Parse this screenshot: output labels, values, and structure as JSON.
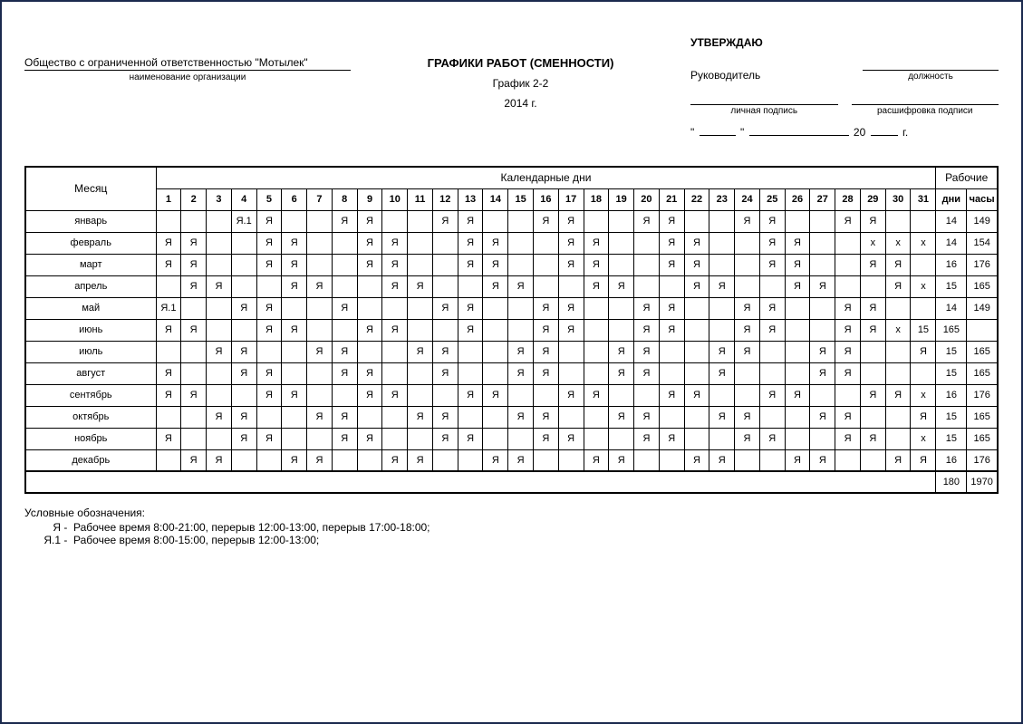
{
  "organization": {
    "name": "Общество с ограниченной ответственностью \"Мотылек\"",
    "sub_label": "наименование организации"
  },
  "title": "ГРАФИКИ РАБОТ (СМЕННОСТИ)",
  "schedule_name": "График 2-2",
  "year_label": "2014 г.",
  "approval": {
    "approve": "УТВЕРЖДАЮ",
    "manager": "Руководитель",
    "position_label": "должность",
    "signature_label": "личная подпись",
    "decryption_label": "расшифровка подписи",
    "date_prefix": "\"",
    "date_mid": "\"",
    "date_year_prefix": "20",
    "date_suffix": "г."
  },
  "table": {
    "month_header": "Месяц",
    "calendar_header": "Календарные дни",
    "work_header": "Рабочие",
    "days_col": "дни",
    "hours_col": "часы",
    "day_numbers": [
      "1",
      "2",
      "3",
      "4",
      "5",
      "6",
      "7",
      "8",
      "9",
      "10",
      "11",
      "12",
      "13",
      "14",
      "15",
      "16",
      "17",
      "18",
      "19",
      "20",
      "21",
      "22",
      "23",
      "24",
      "25",
      "26",
      "27",
      "28",
      "29",
      "30",
      "31"
    ],
    "rows": [
      {
        "month": "январь",
        "cells": [
          "",
          "",
          "",
          "Я.1",
          "Я",
          "",
          "",
          "Я",
          "Я",
          "",
          "",
          "Я",
          "Я",
          "",
          "",
          "Я",
          "Я",
          "",
          "",
          "Я",
          "Я",
          "",
          "",
          "Я",
          "Я",
          "",
          "",
          "Я",
          "Я",
          "",
          ""
        ],
        "days": "14",
        "hours": "149"
      },
      {
        "month": "февраль",
        "cells": [
          "Я",
          "Я",
          "",
          "",
          "Я",
          "Я",
          "",
          "",
          "Я",
          "Я",
          "",
          "",
          "Я",
          "Я",
          "",
          "",
          "Я",
          "Я",
          "",
          "",
          "Я",
          "Я",
          "",
          "",
          "Я",
          "Я",
          "",
          "",
          "х",
          "х",
          "х"
        ],
        "days": "14",
        "hours": "154"
      },
      {
        "month": "март",
        "cells": [
          "Я",
          "Я",
          "",
          "",
          "Я",
          "Я",
          "",
          "",
          "Я",
          "Я",
          "",
          "",
          "Я",
          "Я",
          "",
          "",
          "Я",
          "Я",
          "",
          "",
          "Я",
          "Я",
          "",
          "",
          "Я",
          "Я",
          "",
          "",
          "Я",
          "Я",
          ""
        ],
        "days": "16",
        "hours": "176"
      },
      {
        "month": "апрель",
        "cells": [
          "",
          "Я",
          "Я",
          "",
          "",
          "Я",
          "Я",
          "",
          "",
          "Я",
          "Я",
          "",
          "",
          "Я",
          "Я",
          "",
          "",
          "Я",
          "Я",
          "",
          "",
          "Я",
          "Я",
          "",
          "",
          "Я",
          "Я",
          "",
          "",
          "Я",
          "х"
        ],
        "days": "15",
        "hours": "165"
      },
      {
        "month": "май",
        "cells": [
          "Я.1",
          "",
          "",
          "Я",
          "Я",
          "",
          "",
          "Я",
          "",
          "",
          "",
          "Я",
          "Я",
          "",
          "",
          "Я",
          "Я",
          "",
          "",
          "Я",
          "Я",
          "",
          "",
          "Я",
          "Я",
          "",
          "",
          "Я",
          "Я",
          "",
          ""
        ],
        "days": "14",
        "hours": "149"
      },
      {
        "month": "июнь",
        "cells": [
          "Я",
          "Я",
          "",
          "",
          "Я",
          "Я",
          "",
          "",
          "Я",
          "Я",
          "",
          "",
          "Я",
          "",
          "",
          "Я",
          "Я",
          "",
          "",
          "Я",
          "Я",
          "",
          "",
          "Я",
          "Я",
          "",
          "",
          "Я",
          "Я",
          "х"
        ],
        "days": "15",
        "hours": "165"
      },
      {
        "month": "июль",
        "cells": [
          "",
          "",
          "Я",
          "Я",
          "",
          "",
          "Я",
          "Я",
          "",
          "",
          "Я",
          "Я",
          "",
          "",
          "Я",
          "Я",
          "",
          "",
          "Я",
          "Я",
          "",
          "",
          "Я",
          "Я",
          "",
          "",
          "Я",
          "Я",
          "",
          "",
          "Я"
        ],
        "days": "15",
        "hours": "165"
      },
      {
        "month": "август",
        "cells": [
          "Я",
          "",
          "",
          "Я",
          "Я",
          "",
          "",
          "Я",
          "Я",
          "",
          "",
          "Я",
          "",
          "",
          "Я",
          "Я",
          "",
          "",
          "Я",
          "Я",
          "",
          "",
          "Я",
          "",
          "",
          "",
          "Я",
          "Я",
          "",
          "",
          ""
        ],
        "days": "15",
        "hours": "165"
      },
      {
        "month": "сентябрь",
        "cells": [
          "Я",
          "Я",
          "",
          "",
          "Я",
          "Я",
          "",
          "",
          "Я",
          "Я",
          "",
          "",
          "Я",
          "Я",
          "",
          "",
          "Я",
          "Я",
          "",
          "",
          "Я",
          "Я",
          "",
          "",
          "Я",
          "Я",
          "",
          "",
          "Я",
          "Я",
          "х"
        ],
        "days": "16",
        "hours": "176"
      },
      {
        "month": "октябрь",
        "cells": [
          "",
          "",
          "Я",
          "Я",
          "",
          "",
          "Я",
          "Я",
          "",
          "",
          "Я",
          "Я",
          "",
          "",
          "Я",
          "Я",
          "",
          "",
          "Я",
          "Я",
          "",
          "",
          "Я",
          "Я",
          "",
          "",
          "Я",
          "Я",
          "",
          "",
          "Я"
        ],
        "days": "15",
        "hours": "165"
      },
      {
        "month": "ноябрь",
        "cells": [
          "Я",
          "",
          "",
          "Я",
          "Я",
          "",
          "",
          "Я",
          "Я",
          "",
          "",
          "Я",
          "Я",
          "",
          "",
          "Я",
          "Я",
          "",
          "",
          "Я",
          "Я",
          "",
          "",
          "Я",
          "Я",
          "",
          "",
          "Я",
          "Я",
          "",
          "х"
        ],
        "days": "15",
        "hours": "165"
      },
      {
        "month": "декабрь",
        "cells": [
          "",
          "Я",
          "Я",
          "",
          "",
          "Я",
          "Я",
          "",
          "",
          "Я",
          "Я",
          "",
          "",
          "Я",
          "Я",
          "",
          "",
          "Я",
          "Я",
          "",
          "",
          "Я",
          "Я",
          "",
          "",
          "Я",
          "Я",
          "",
          "",
          "Я",
          "Я"
        ],
        "days": "16",
        "hours": "176"
      }
    ],
    "totals": {
      "days": "180",
      "hours": "1970"
    }
  },
  "legend": {
    "title": "Условные обозначения:",
    "items": [
      {
        "key": "Я",
        "desc": "Рабочее время 8:00-21:00, перерыв 12:00-13:00, перерыв 17:00-18:00;"
      },
      {
        "key": "Я.1",
        "desc": "Рабочее время 8:00-15:00, перерыв 12:00-13:00;"
      }
    ]
  }
}
